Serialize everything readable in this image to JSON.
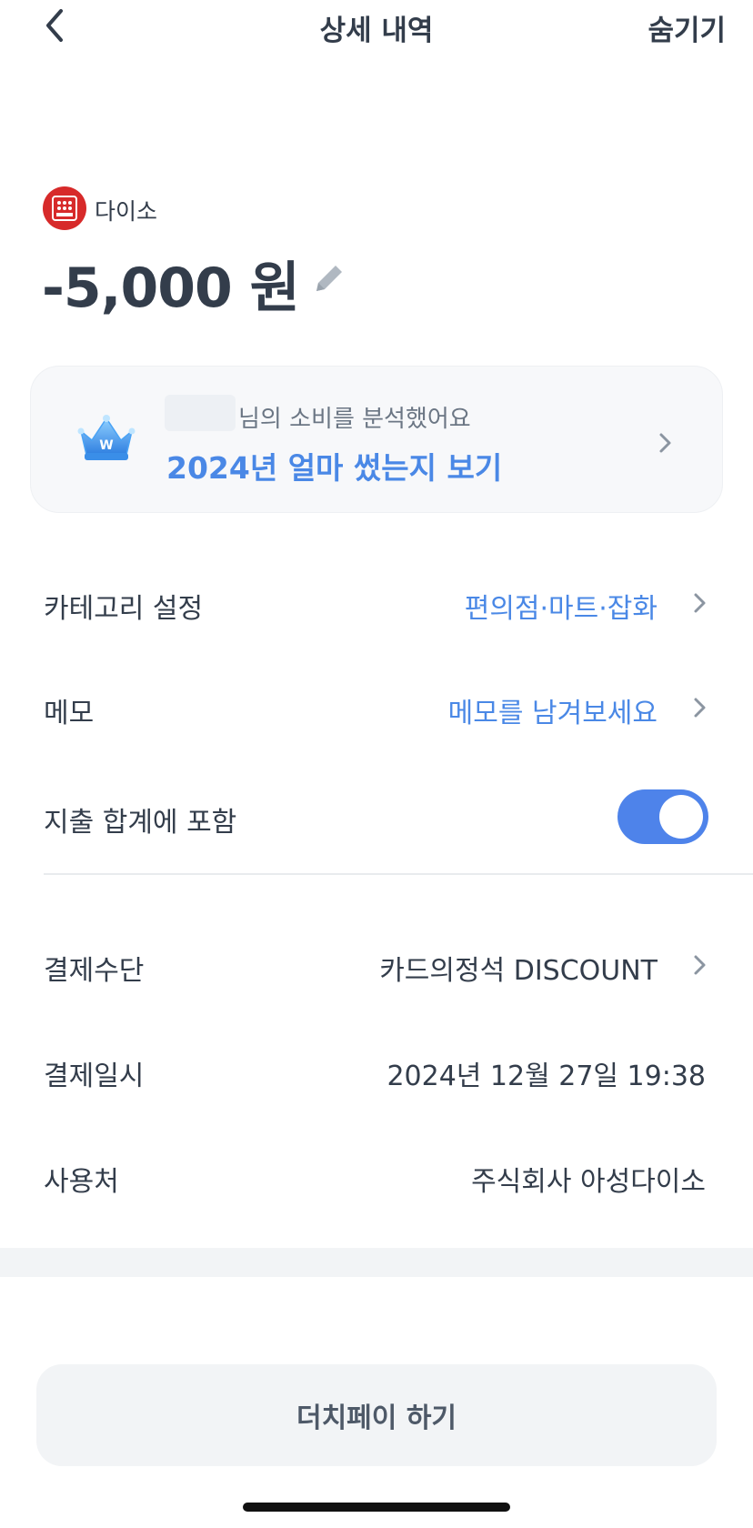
{
  "header": {
    "title": "상세 내역",
    "hide_label": "숨기기"
  },
  "merchant": {
    "name": "다이소",
    "amount": "-5,000 원",
    "logo_color": "#d72a2a"
  },
  "analysis_card": {
    "subtitle": "님의 소비를 분석했어요",
    "title": "2024년 얼마 썼는지 보기"
  },
  "details": {
    "category": {
      "label": "카테고리 설정",
      "value": "편의점·마트·잡화"
    },
    "memo": {
      "label": "메모",
      "value": "메모를 남겨보세요"
    },
    "include_total": {
      "label": "지출 합계에 포함",
      "enabled": true
    },
    "payment_method": {
      "label": "결제수단",
      "value": "카드의정석 DISCOUNT"
    },
    "payment_datetime": {
      "label": "결제일시",
      "value": "2024년 12월 27일 19:38"
    },
    "merchant_place": {
      "label": "사용처",
      "value": "주식회사 아성다이소"
    }
  },
  "footer": {
    "dutch_pay_label": "더치페이 하기"
  },
  "colors": {
    "accent": "#4a88e6",
    "toggle_on": "#4e83ea",
    "text": "#333d4b"
  }
}
